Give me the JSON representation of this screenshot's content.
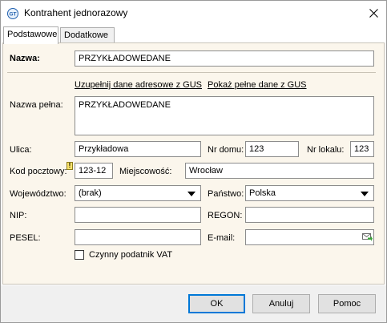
{
  "window": {
    "title": "Kontrahent jednorazowy",
    "app_icon": "gt-app-icon",
    "close_icon": "close-icon"
  },
  "tabs": [
    {
      "label": "Podstawowe",
      "active": true
    },
    {
      "label": "Dodatkowe",
      "active": false
    }
  ],
  "form": {
    "nazwa": {
      "label": "Nazwa:",
      "value": "PRZYKŁADOWEDANE"
    },
    "links": {
      "uzupelnij": "Uzupełnij dane adresowe z GUS",
      "pokaz": "Pokaż pełne dane z GUS"
    },
    "nazwa_pelna": {
      "label": "Nazwa pełna:",
      "value": "PRZYKŁADOWEDANE"
    },
    "ulica": {
      "label": "Ulica:",
      "value": "Przykładowa"
    },
    "nr_domu": {
      "label": "Nr domu:",
      "value": "123"
    },
    "nr_lokalu": {
      "label": "Nr lokalu:",
      "value": "123"
    },
    "kod_pocztowy": {
      "label": "Kod pocztowy:",
      "value": "123-12",
      "warning_mark": "!"
    },
    "miejscowosc": {
      "label": "Miejscowość:",
      "value": "Wrocław"
    },
    "wojewodztwo": {
      "label": "Województwo:",
      "value": "(brak)"
    },
    "panstwo": {
      "label": "Państwo:",
      "value": "Polska"
    },
    "nip": {
      "label": "NIP:",
      "value": ""
    },
    "regon": {
      "label": "REGON:",
      "value": ""
    },
    "pesel": {
      "label": "PESEL:",
      "value": ""
    },
    "email": {
      "label": "E-mail:",
      "value": "",
      "icon": "send-email-icon"
    },
    "vat": {
      "label": "Czynny podatnik VAT",
      "checked": false
    }
  },
  "buttons": {
    "ok": "OK",
    "cancel": "Anuluj",
    "help": "Pomoc"
  },
  "colors": {
    "panel_bg": "#fbf6ec",
    "accent": "#0078d7"
  }
}
